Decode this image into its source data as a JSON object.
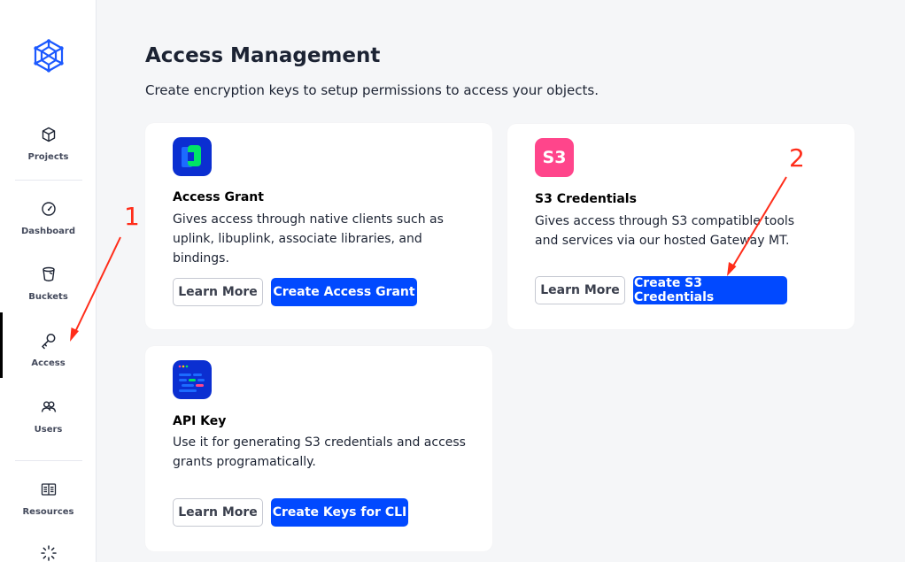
{
  "sidebar": {
    "items": [
      {
        "label": "Projects",
        "icon": "cube-icon"
      },
      {
        "label": "Dashboard",
        "icon": "gauge-icon"
      },
      {
        "label": "Buckets",
        "icon": "bucket-icon"
      },
      {
        "label": "Access",
        "icon": "key-icon",
        "active": true
      },
      {
        "label": "Users",
        "icon": "users-icon"
      },
      {
        "label": "Resources",
        "icon": "book-icon"
      }
    ]
  },
  "main": {
    "title": "Access Management",
    "subtitle": "Create encryption keys to setup permissions to access your objects.",
    "cards": {
      "access_grant": {
        "title": "Access Grant",
        "description": "Gives access through native clients such as uplink, libuplink, associate libraries, and bindings.",
        "learn_more": "Learn More",
        "primary": "Create Access Grant"
      },
      "s3": {
        "icon_text": "S3",
        "title": "S3 Credentials",
        "description": "Gives access through S3 compatible tools and services via our hosted Gateway MT.",
        "learn_more": "Learn More",
        "primary": "Create S3 Credentials"
      },
      "api_key": {
        "title": "API Key",
        "description": "Use it for generating S3 credentials and access grants programatically.",
        "learn_more": "Learn More",
        "primary": "Create Keys for CLI"
      }
    }
  },
  "annotations": {
    "label_1": "1",
    "label_2": "2"
  },
  "colors": {
    "primary": "#0149ff",
    "annotation": "#ff2d1a",
    "s3_badge": "#ff458b",
    "grant_icon_bg": "#0b2fd1",
    "grant_icon_accent": "#00e566"
  }
}
